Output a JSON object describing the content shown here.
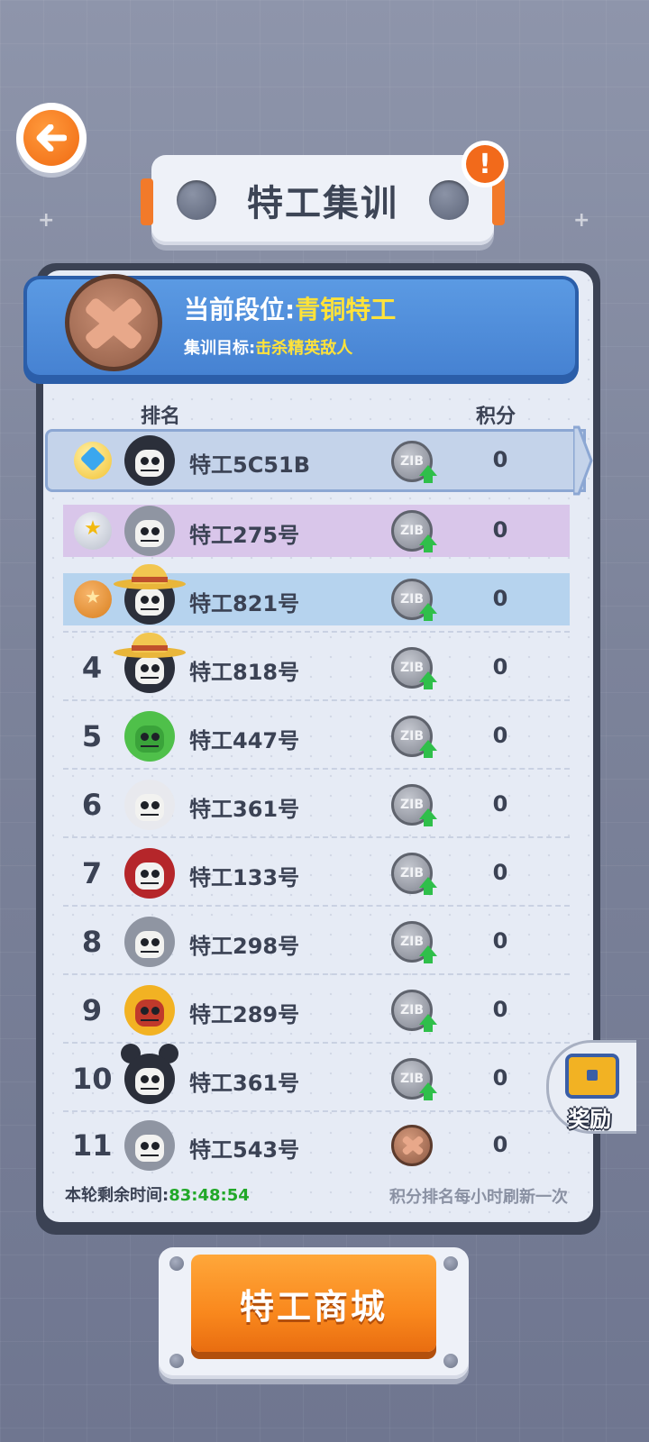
{
  "header": {
    "title": "特工集训",
    "info_icon": "!"
  },
  "rank_info": {
    "current_label": "当前段位:",
    "current_value": "青铜特工",
    "goal_label": "集训目标:",
    "goal_value": "击杀精英敌人"
  },
  "columns": {
    "rank": "排名",
    "score": "积分"
  },
  "leaderboard": [
    {
      "rank": "",
      "badge": "diamond-badge",
      "name": "特工5C51B",
      "coin": "ZIB",
      "score": "0"
    },
    {
      "rank": "",
      "badge": "silver-star-badge",
      "name": "特工275号",
      "coin": "ZIB",
      "score": "0"
    },
    {
      "rank": "",
      "badge": "bronze-star-badge",
      "name": "特工821号",
      "coin": "ZIB",
      "score": "0"
    },
    {
      "rank": "4",
      "name": "特工818号",
      "coin": "ZIB",
      "score": "0"
    },
    {
      "rank": "5",
      "name": "特工447号",
      "coin": "ZIB",
      "score": "0"
    },
    {
      "rank": "6",
      "name": "特工361号",
      "coin": "ZIB",
      "score": "0"
    },
    {
      "rank": "7",
      "name": "特工133号",
      "coin": "ZIB",
      "score": "0"
    },
    {
      "rank": "8",
      "name": "特工298号",
      "coin": "ZIB",
      "score": "0"
    },
    {
      "rank": "9",
      "name": "特工289号",
      "coin": "ZIB",
      "score": "0"
    },
    {
      "rank": "10",
      "name": "特工361号",
      "coin": "ZIB",
      "score": "0"
    },
    {
      "rank": "11",
      "name": "特工543号",
      "coin": "",
      "score": "0"
    }
  ],
  "footer": {
    "remaining_label": "本轮剩余时间:",
    "remaining_value": "83:48:54",
    "refresh_note": "积分排名每小时刷新一次"
  },
  "reward_button": {
    "label": "奖励"
  },
  "shop_button": {
    "label": "特工商城"
  },
  "colors": {
    "accent_orange": "#f9881d",
    "highlight_yellow": "#ffe23a",
    "timer_green": "#22a829",
    "rank_banner_blue": "#4682d2"
  }
}
